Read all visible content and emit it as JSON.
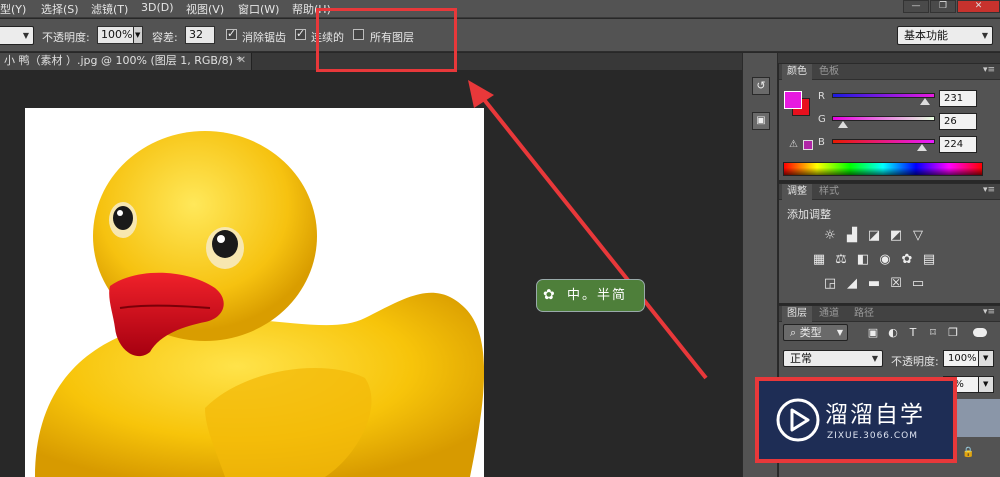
{
  "menubar": {
    "items": [
      "型(Y)",
      "选择(S)",
      "滤镜(T)",
      "3D(D)",
      "视图(V)",
      "窗口(W)",
      "帮助(H)"
    ],
    "window_buttons": [
      "—",
      "❐",
      "✕"
    ]
  },
  "options": {
    "opacity_label": "不透明度:",
    "opacity_value": "100%",
    "tolerance_label": "容差:",
    "tolerance_value": "32",
    "antialias_label": "消除锯齿",
    "contiguous_label": "连续的",
    "all_layers_label": "所有图层",
    "workspace": "基本功能"
  },
  "document": {
    "tab_title": "小 鸭（素材 ）.jpg @ 100% (图层 1, RGB/8) *",
    "close_glyph": "✕"
  },
  "color_panel": {
    "tabs": [
      "颜色",
      "色板"
    ],
    "channels": [
      {
        "label": "R",
        "value": "231",
        "level": 0.906
      },
      {
        "label": "G",
        "value": "26",
        "level": 0.102
      },
      {
        "label": "B",
        "value": "224",
        "level": 0.878
      }
    ],
    "fg_color": "#e71ae0",
    "bg_color": "#e8101e"
  },
  "adjust_panel": {
    "tabs": [
      "调整",
      "样式"
    ],
    "title": "添加调整"
  },
  "layers_panel": {
    "tabs": [
      "图层",
      "通道",
      "路径"
    ],
    "filter_kind": "类型",
    "blend_mode": "正常",
    "opacity_label": "不透明度:",
    "opacity_value": "100%",
    "fill_value_partial": "0%"
  },
  "overlay": {
    "watermark_text": "中。半简",
    "logo_title": "溜溜自学",
    "logo_url": "ZIXUE.3066.COM"
  },
  "colors": {
    "accent_red": "#e8383a"
  }
}
